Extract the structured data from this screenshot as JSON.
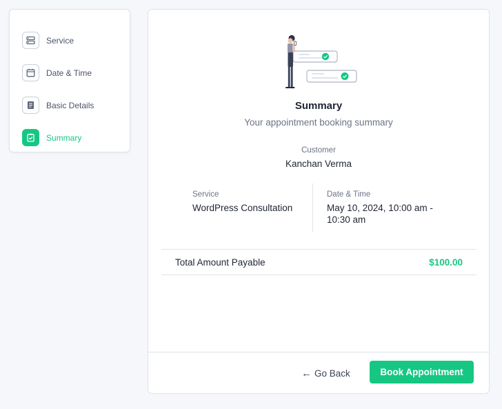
{
  "steps": [
    {
      "label": "Service",
      "icon": "service-icon",
      "active": false
    },
    {
      "label": "Date & Time",
      "icon": "calendar-icon",
      "active": false
    },
    {
      "label": "Basic Details",
      "icon": "document-icon",
      "active": false
    },
    {
      "label": "Summary",
      "icon": "checklist-icon",
      "active": true
    }
  ],
  "summary": {
    "title": "Summary",
    "subtitle": "Your appointment booking summary",
    "customer_label": "Customer",
    "customer_name": "Kanchan Verma",
    "service_label": "Service",
    "service_value": "WordPress Consultation",
    "datetime_label": "Date & Time",
    "datetime_value": "May 10, 2024, 10:00 am - 10:30 am",
    "total_label": "Total Amount Payable",
    "total_amount": "$100.00"
  },
  "footer": {
    "back_label": "Go Back",
    "book_label": "Book Appointment"
  },
  "colors": {
    "accent": "#16c784",
    "border": "#dfe2ea",
    "text": "#1e2433",
    "muted": "#6b7385"
  }
}
